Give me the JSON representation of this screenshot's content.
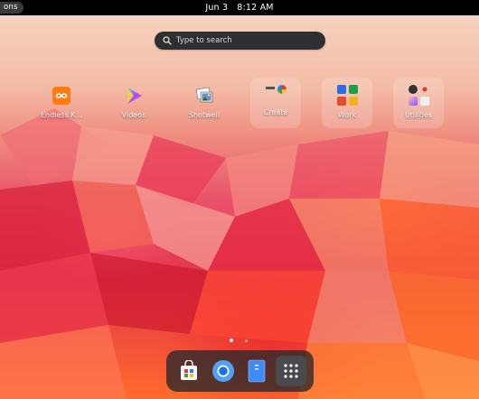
{
  "topbar": {
    "activities_label": "ons",
    "date": "Jun 3",
    "time": "8:12 AM"
  },
  "search": {
    "placeholder": "Type to search"
  },
  "apps": [
    {
      "label": "Endless K...",
      "icon": "endless-key-icon"
    },
    {
      "label": "Videos",
      "icon": "videos-icon"
    },
    {
      "label": "Shotwell",
      "icon": "shotwell-icon"
    },
    {
      "label": "Create",
      "icon": "folder-create-icon"
    },
    {
      "label": "Work",
      "icon": "folder-work-icon"
    },
    {
      "label": "Utilities",
      "icon": "folder-utilities-icon"
    }
  ],
  "pagination": {
    "pages": 2,
    "current": 1
  },
  "dock": [
    {
      "name": "software-store",
      "icon": "software-store-icon"
    },
    {
      "name": "chromium",
      "icon": "chromium-icon"
    },
    {
      "name": "files",
      "icon": "files-icon"
    },
    {
      "name": "app-grid",
      "icon": "app-grid-icon"
    }
  ],
  "colors": {
    "topbar": "#000000",
    "search_bg": "#2f2f31",
    "dock_bg": "#28282a"
  }
}
